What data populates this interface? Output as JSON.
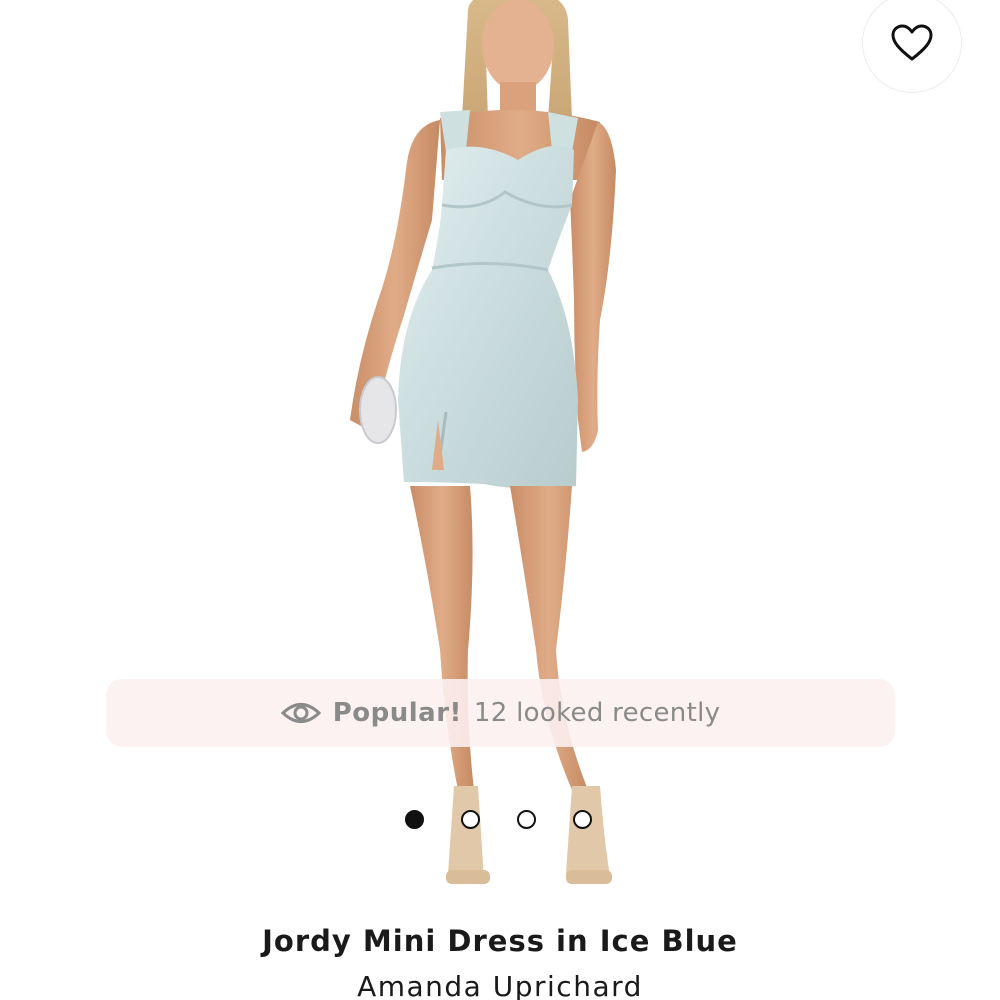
{
  "product": {
    "title": "Jordy Mini Dress in Ice Blue",
    "brand": "Amanda Uprichard",
    "image": "model-wearing-ice-blue-mini-dress"
  },
  "favorite": {
    "icon": "heart-outline-icon"
  },
  "popular_banner": {
    "icon": "eye-icon",
    "highlight": "Popular!",
    "text": "12 looked recently"
  },
  "carousel": {
    "total": 4,
    "active_index": 1
  },
  "colors": {
    "dress": "#d3e3e4",
    "skin": "#d9a27c",
    "banner_bg": "#fcf0f0",
    "text_muted": "#8a8a8a",
    "text_dark": "#1a1a1a"
  }
}
